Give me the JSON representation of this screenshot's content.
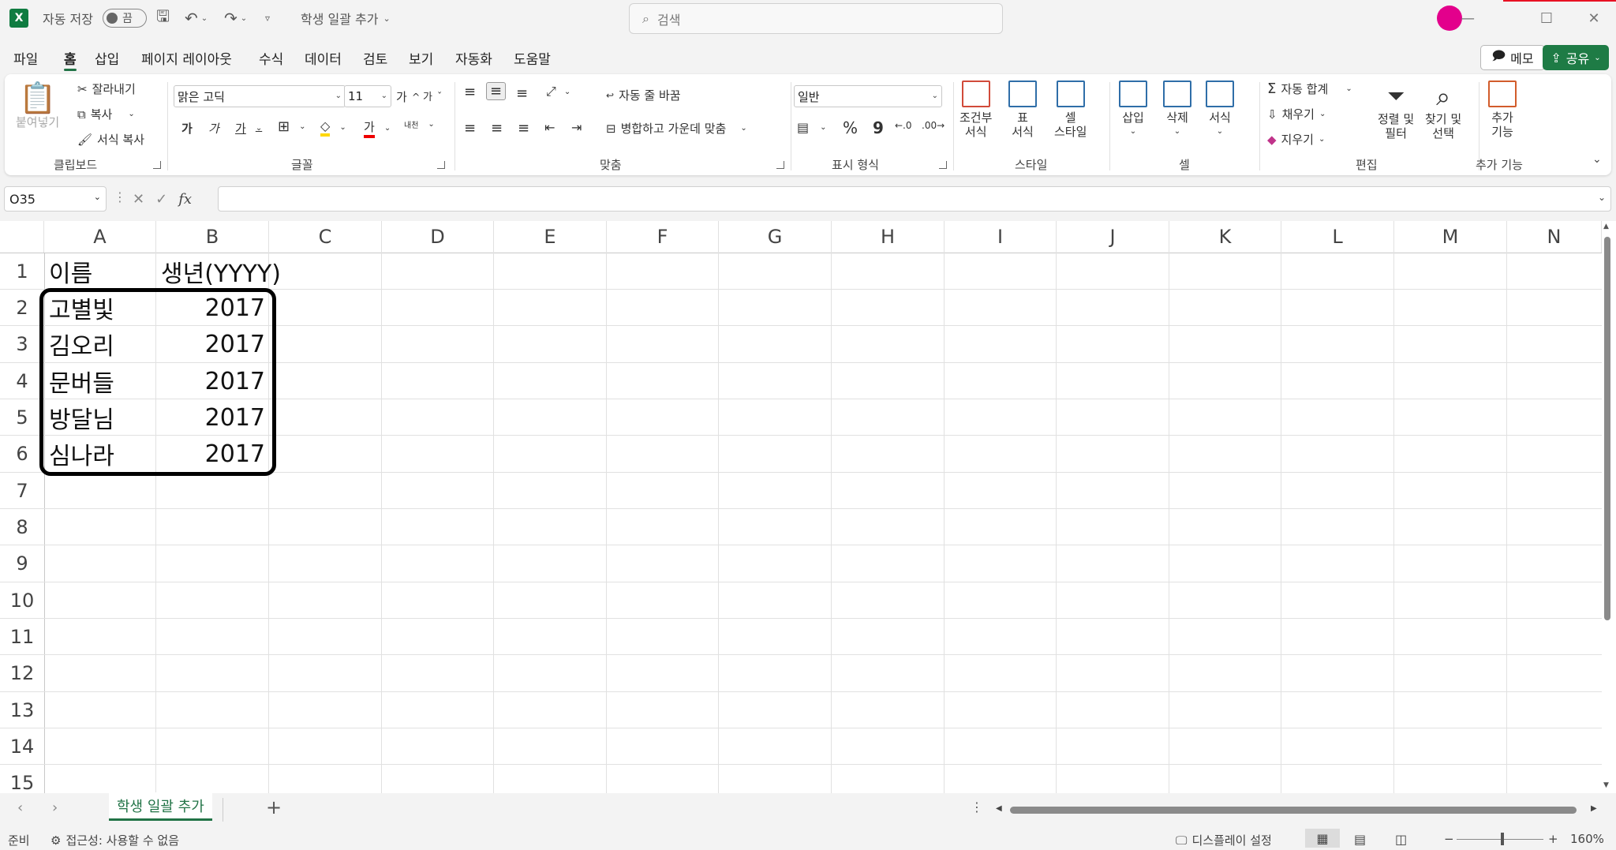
{
  "titlebar": {
    "autosave_label": "자동 저장",
    "autosave_state": "끔",
    "file_name": "학생 일괄 추가",
    "search_placeholder": "검색"
  },
  "menu": {
    "tabs": [
      "파일",
      "홈",
      "삽입",
      "페이지 레이아웃",
      "수식",
      "데이터",
      "검토",
      "보기",
      "자동화",
      "도움말"
    ],
    "active": "홈",
    "memo_label": "메모",
    "share_label": "공유"
  },
  "ribbon": {
    "clipboard": {
      "paste": "붙여넣기",
      "cut": "잘라내기",
      "copy": "복사",
      "format_painter": "서식 복사",
      "group": "클립보드"
    },
    "font": {
      "name": "맑은 고딕",
      "size": "11",
      "grow": "가",
      "shrink": "가",
      "bold": "가",
      "italic": "가",
      "underline": "가",
      "font_color": "가",
      "phonetic": "내천",
      "group": "글꼴"
    },
    "alignment": {
      "wrap": "자동 줄 바꿈",
      "merge": "병합하고 가운데 맞춤",
      "group": "맞춤"
    },
    "number": {
      "format": "일반",
      "percent": "%",
      "comma": "9",
      "group": "표시 형식"
    },
    "styles": {
      "conditional_1": "조건부",
      "conditional_2": "서식",
      "table_1": "표",
      "table_2": "서식",
      "cell_1": "셀",
      "cell_2": "스타일",
      "group": "스타일"
    },
    "cells": {
      "insert": "삽입",
      "delete": "삭제",
      "format": "서식",
      "group": "셀"
    },
    "editing": {
      "autosum": "자동 합계",
      "fill": "채우기",
      "clear": "지우기",
      "sort_1": "정렬 및",
      "sort_2": "필터",
      "find_1": "찾기 및",
      "find_2": "선택",
      "group": "편집"
    },
    "addins": {
      "label_1": "추가",
      "label_2": "기능",
      "group": "추가 기능"
    }
  },
  "formula_bar": {
    "name_box": "O35",
    "fx": "fx",
    "formula": ""
  },
  "grid": {
    "columns": [
      "A",
      "B",
      "C",
      "D",
      "E",
      "F",
      "G",
      "H",
      "I",
      "J",
      "K",
      "L",
      "M",
      "N"
    ],
    "rows": [
      "1",
      "2",
      "3",
      "4",
      "5",
      "6",
      "7",
      "8",
      "9",
      "10",
      "11",
      "12",
      "13",
      "14",
      "15"
    ],
    "header": {
      "a": "이름",
      "b": "생년(YYYY)"
    },
    "data": [
      {
        "name": "고별빛",
        "year": "2017"
      },
      {
        "name": "김오리",
        "year": "2017"
      },
      {
        "name": "문버들",
        "year": "2017"
      },
      {
        "name": "방달님",
        "year": "2017"
      },
      {
        "name": "심나라",
        "year": "2017"
      }
    ]
  },
  "sheets": {
    "active": "학생 일괄 추가",
    "add": "+"
  },
  "status": {
    "ready": "준비",
    "accessibility": "접근성: 사용할 수 없음",
    "display": "디스플레이 설정",
    "zoom": "160%"
  },
  "colors": {
    "accent": "#217346",
    "avatar": "#e3008c"
  }
}
